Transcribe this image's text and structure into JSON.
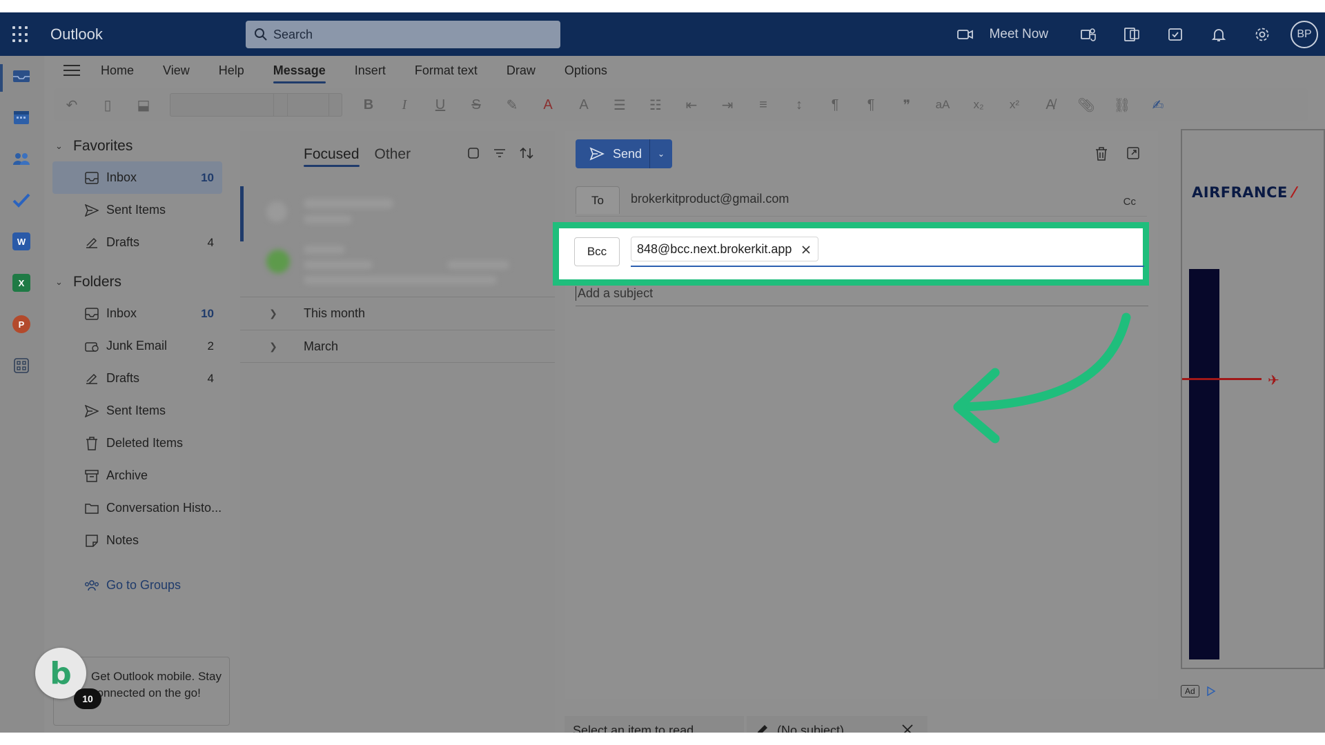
{
  "topbar": {
    "app_name": "Outlook",
    "search_placeholder": "Search",
    "meet_now": "Meet Now",
    "avatar_initials": "BP"
  },
  "ribbon_tabs": [
    "Home",
    "View",
    "Help",
    "Message",
    "Insert",
    "Format text",
    "Draw",
    "Options"
  ],
  "active_tab": "Message",
  "favorites": {
    "title": "Favorites",
    "items": [
      {
        "label": "Inbox",
        "count": "10",
        "icon": "inbox-icon"
      },
      {
        "label": "Sent Items",
        "count": "",
        "icon": "send-icon"
      },
      {
        "label": "Drafts",
        "count": "4",
        "icon": "drafts-icon"
      }
    ]
  },
  "folders": {
    "title": "Folders",
    "items": [
      {
        "label": "Inbox",
        "count": "10",
        "icon": "inbox-icon"
      },
      {
        "label": "Junk Email",
        "count": "2",
        "icon": "junk-icon"
      },
      {
        "label": "Drafts",
        "count": "4",
        "icon": "drafts-icon"
      },
      {
        "label": "Sent Items",
        "count": "",
        "icon": "send-icon"
      },
      {
        "label": "Deleted Items",
        "count": "",
        "icon": "trash-icon"
      },
      {
        "label": "Archive",
        "count": "",
        "icon": "archive-icon"
      },
      {
        "label": "Conversation Histo...",
        "count": "",
        "icon": "folder-icon"
      },
      {
        "label": "Notes",
        "count": "",
        "icon": "notes-icon"
      }
    ],
    "go_to_groups": "Go to Groups"
  },
  "promo": {
    "text": "Get Outlook mobile. Stay connected on the go!",
    "badge_count": "10"
  },
  "message_list": {
    "tabs": [
      "Focused",
      "Other"
    ],
    "groups": [
      "This month",
      "March"
    ]
  },
  "compose": {
    "send_label": "Send",
    "to_label": "To",
    "to_value": "brokerkitproduct@gmail.com",
    "cc_label": "Cc",
    "bcc_label": "Bcc",
    "bcc_value": "848@bcc.next.brokerkit.app",
    "subject_placeholder": "Add a subject"
  },
  "ad": {
    "brand": "AIRFRANCE",
    "ad_tag": "Ad"
  },
  "bottom_bar": {
    "read_label": "Select an item to read",
    "draft_label": "(No subject)"
  },
  "colors": {
    "highlight": "#1fbe7c",
    "topbar": "#0f2b57",
    "send": "#2c5294"
  }
}
